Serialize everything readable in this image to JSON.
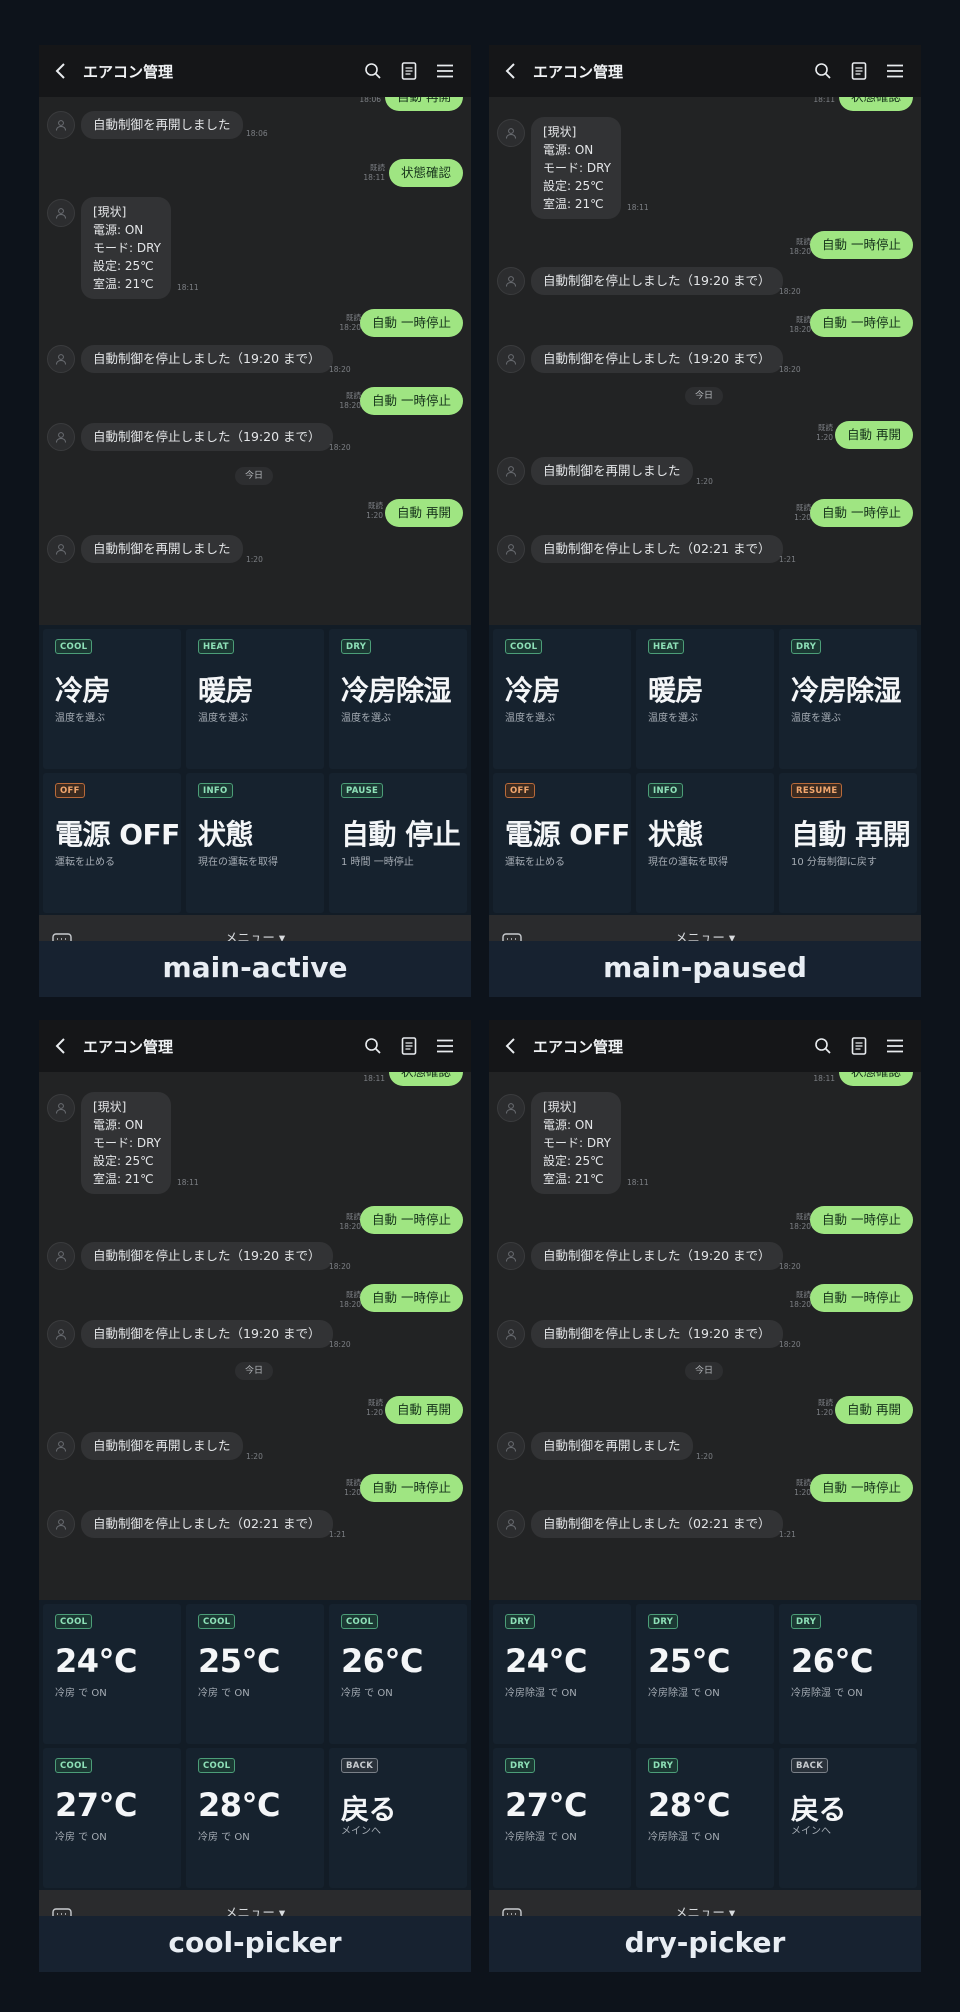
{
  "app": {
    "title": "エアコン管理",
    "menu_label": "メニュー ▾"
  },
  "messages": {
    "resumed": "自動制御を再開しました",
    "check": "状態確認",
    "status_lines": [
      "[現状]",
      "電源: ON",
      "モード: DRY",
      "設定: 25℃",
      "室温: 21℃"
    ],
    "pause": "自動 一時停止",
    "stopped_1920": "自動制御を停止しました（19:20 まで）",
    "stopped_0221": "自動制御を停止しました（02:21 まで）",
    "resume": "自動 再開",
    "today": "今日",
    "read": "既読",
    "t_1806": "18:06",
    "t_1811": "18:11",
    "t_1820": "18:20",
    "t_120": "1:20",
    "t_121": "1:21"
  },
  "screens": [
    {
      "caption": "main-active",
      "tiles": [
        {
          "tag": "COOL",
          "title": "冷房",
          "sub": "温度を選ぶ"
        },
        {
          "tag": "HEAT",
          "title": "暖房",
          "sub": "温度を選ぶ"
        },
        {
          "tag": "DRY",
          "title": "冷房除湿",
          "sub": "温度を選ぶ"
        },
        {
          "tag": "OFF",
          "title": "電源 OFF",
          "sub": "運転を止める"
        },
        {
          "tag": "INFO",
          "title": "状態",
          "sub": "現在の運転を取得"
        },
        {
          "tag": "PAUSE",
          "title": "自動 停止",
          "sub": "1 時間 一時停止"
        }
      ]
    },
    {
      "caption": "main-paused",
      "tiles": [
        {
          "tag": "COOL",
          "title": "冷房",
          "sub": "温度を選ぶ"
        },
        {
          "tag": "HEAT",
          "title": "暖房",
          "sub": "温度を選ぶ"
        },
        {
          "tag": "DRY",
          "title": "冷房除湿",
          "sub": "温度を選ぶ"
        },
        {
          "tag": "OFF",
          "title": "電源 OFF",
          "sub": "運転を止める"
        },
        {
          "tag": "INFO",
          "title": "状態",
          "sub": "現在の運転を取得"
        },
        {
          "tag": "RESUME",
          "title": "自動 再開",
          "sub": "10 分毎制御に戻す"
        }
      ]
    },
    {
      "caption": "cool-picker",
      "tiles": [
        {
          "tag": "COOL",
          "title": "24°C",
          "sub": "冷房 で ON"
        },
        {
          "tag": "COOL",
          "title": "25°C",
          "sub": "冷房 で ON"
        },
        {
          "tag": "COOL",
          "title": "26°C",
          "sub": "冷房 で ON"
        },
        {
          "tag": "COOL",
          "title": "27°C",
          "sub": "冷房 で ON"
        },
        {
          "tag": "COOL",
          "title": "28°C",
          "sub": "冷房 で ON"
        },
        {
          "tag": "BACK",
          "title": "戻る",
          "sub": "メインへ"
        }
      ]
    },
    {
      "caption": "dry-picker",
      "tiles": [
        {
          "tag": "DRY",
          "title": "24°C",
          "sub": "冷房除湿 で ON"
        },
        {
          "tag": "DRY",
          "title": "25°C",
          "sub": "冷房除湿 で ON"
        },
        {
          "tag": "DRY",
          "title": "26°C",
          "sub": "冷房除湿 で ON"
        },
        {
          "tag": "DRY",
          "title": "27°C",
          "sub": "冷房除湿 で ON"
        },
        {
          "tag": "DRY",
          "title": "28°C",
          "sub": "冷房除湿 で ON"
        },
        {
          "tag": "BACK",
          "title": "戻る",
          "sub": "メインへ"
        }
      ]
    }
  ],
  "colors": {
    "page_bg": "#0d131b",
    "user_bubble": "#9fe582",
    "bot_bubble": "#323335",
    "tile_bg": "#16222e",
    "tag_green": "#8ee1b8",
    "tag_orange": "#f1a76e"
  }
}
